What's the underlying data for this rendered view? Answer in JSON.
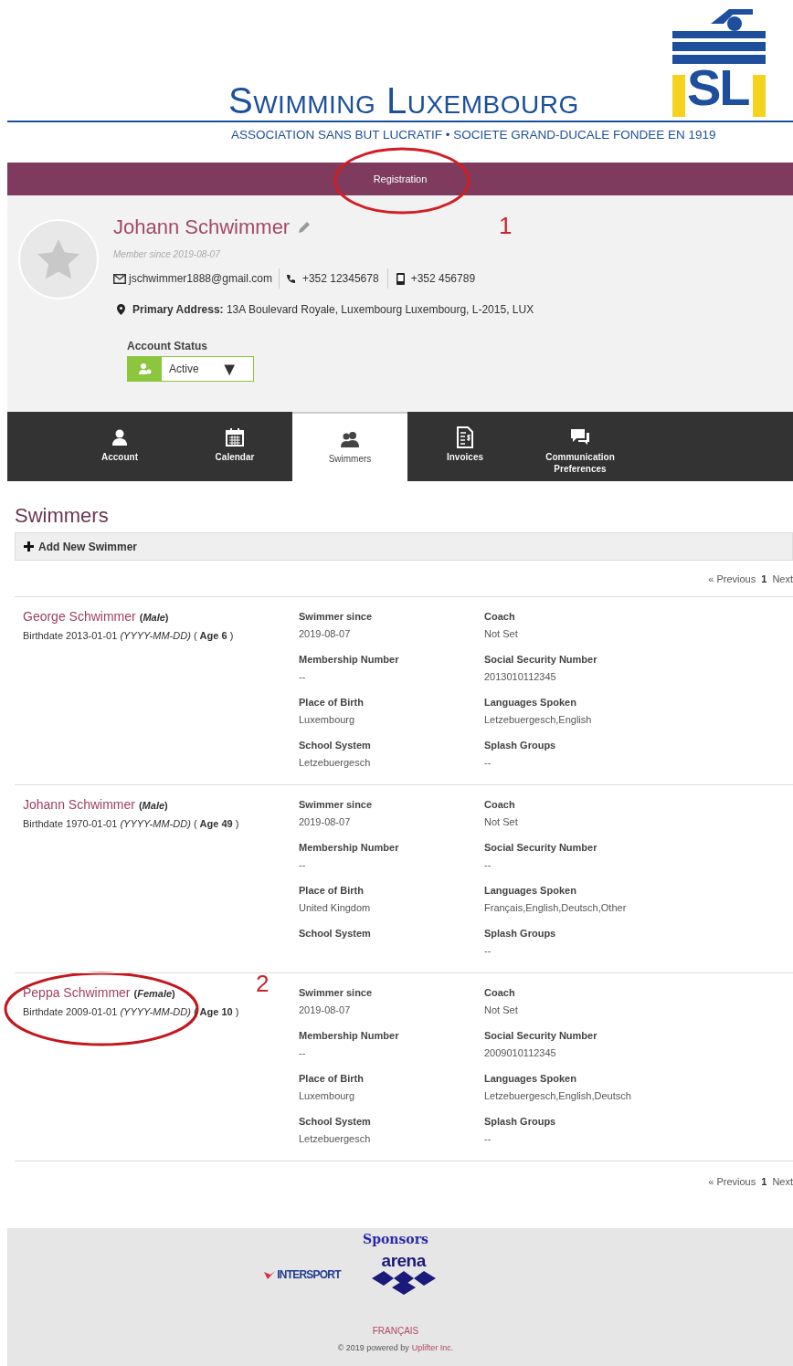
{
  "header": {
    "logo_text": "SL",
    "title": "Swimming Luxembourg",
    "subtitle": "ASSOCIATION SANS BUT LUCRATIF • SOCIETE GRAND-DUCALE FONDEE EN 1919"
  },
  "nav": {
    "items": [
      {
        "label": "Registration"
      }
    ]
  },
  "profile": {
    "name": "Johann Schwimmer",
    "member_since": "Member since 2019-08-07",
    "email": "jschwimmer1888@gmail.com",
    "phone": "+352 12345678",
    "mobile": "+352 456789",
    "address": "**Primary Address:** 13A Boulevard Royale, Luxembourg Luxembourg, L-2015, LUX",
    "account_status": {
      "label": "Account Status",
      "value": "Active",
      "caret": "▼"
    }
  },
  "tabs": [
    {
      "label": "Account",
      "selected": false
    },
    {
      "label": "Calendar",
      "selected": false
    },
    {
      "label": "Swimmers",
      "selected": true
    },
    {
      "label": "Invoices",
      "selected": false
    },
    {
      "label": "Communication Preferences",
      "selected": false
    }
  ],
  "section_title": "Swimmers",
  "add_button": "Add New Swimmer",
  "pagination_top": [
    {
      "label": "« Previous",
      "current": false
    },
    {
      "label": "1",
      "current": true
    },
    {
      "label": "Next",
      "current": false
    }
  ],
  "pagination_bottom": [
    {
      "label": "« Previous",
      "current": false
    },
    {
      "label": "1",
      "current": true
    },
    {
      "label": "Next",
      "current": false
    }
  ],
  "swimmers": [
    {
      "name": "George Schwimmer",
      "gender": "(*Male*)",
      "birthdate": "Birthdate 2013-01-01 *(YYYY-MM-DD)* ( **Age 6** )",
      "fields": [
        {
          "label": "Swimmer since",
          "value": "2019-08-07"
        },
        {
          "label": "Coach",
          "value": "Not Set"
        },
        {
          "label": "Membership Number",
          "value": "--"
        },
        {
          "label": "Social Security Number",
          "value": "2013010112345"
        },
        {
          "label": "Place of Birth",
          "value": "Luxembourg"
        },
        {
          "label": "Languages Spoken",
          "value": "Letzebuergesch,English"
        },
        {
          "label": "School System",
          "value": "Letzebuergesch"
        },
        {
          "label": "Splash Groups",
          "value": "--"
        }
      ]
    },
    {
      "name": "Johann Schwimmer",
      "gender": "(*Male*)",
      "birthdate": "Birthdate 1970-01-01 *(YYYY-MM-DD)* ( **Age 49** )",
      "fields": [
        {
          "label": "Swimmer since",
          "value": "2019-08-07"
        },
        {
          "label": "Coach",
          "value": "Not Set"
        },
        {
          "label": "Membership Number",
          "value": "--"
        },
        {
          "label": "Social Security Number",
          "value": "--"
        },
        {
          "label": "Place of Birth",
          "value": "United Kingdom"
        },
        {
          "label": "Languages Spoken",
          "value": "Français,English,Deutsch,Other"
        },
        {
          "label": "School System"
        },
        {
          "label": "Splash Groups",
          "value": "--"
        }
      ]
    },
    {
      "name": "Peppa Schwimmer",
      "gender": "(*Female*)",
      "birthdate": "Birthdate 2009-01-01 *(YYYY-MM-DD)* ( **Age 10** )",
      "fields": [
        {
          "label": "Swimmer since",
          "value": "2019-08-07"
        },
        {
          "label": "Coach",
          "value": "Not Set"
        },
        {
          "label": "Membership Number",
          "value": "--"
        },
        {
          "label": "Social Security Number",
          "value": "2009010112345"
        },
        {
          "label": "Place of Birth",
          "value": "Luxembourg"
        },
        {
          "label": "Languages Spoken",
          "value": "Letzebuergesch,English,Deutsch"
        },
        {
          "label": "School System",
          "value": "Letzebuergesch"
        },
        {
          "label": "Splash Groups",
          "value": "--"
        }
      ]
    }
  ],
  "footer": {
    "sponsors_title": "Sponsors",
    "sponsors": [
      "INTERSPORT",
      "arena"
    ],
    "language_link": "FRANÇAIS",
    "copyright": "© 2019 powered by",
    "copyright_link": "Uplifter Inc."
  },
  "annotations": [
    {
      "label": "1"
    },
    {
      "label": "2"
    }
  ]
}
